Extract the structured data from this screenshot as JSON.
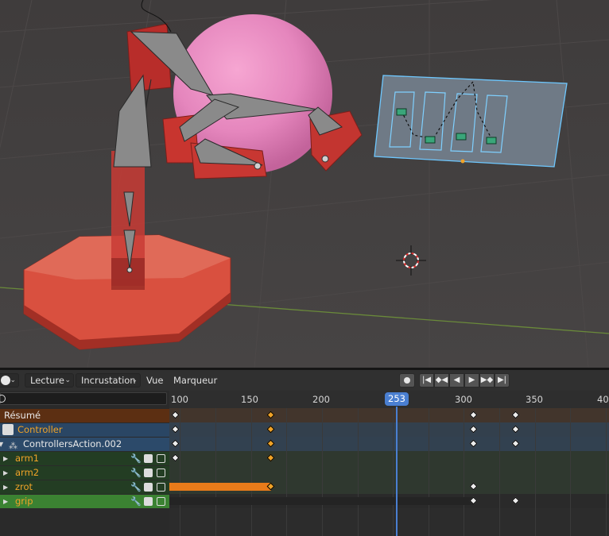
{
  "header": {
    "mode_icon": "dopesheet-mode-icon",
    "menus": {
      "playback": "Lecture",
      "keying": "Incrustation",
      "view": "Vue",
      "marker": "Marqueur"
    },
    "playback_buttons": [
      "record-icon",
      "jump-start-icon",
      "prev-keyframe-icon",
      "play-reverse-icon",
      "play-icon",
      "next-keyframe-icon",
      "jump-end-icon"
    ]
  },
  "timeline": {
    "current_frame": "253",
    "tick_labels": [
      "100",
      "150",
      "200",
      "250",
      "300",
      "350",
      "40"
    ]
  },
  "channels": [
    {
      "label": "Résumé",
      "kind": "summary"
    },
    {
      "label": "Controller",
      "kind": "object"
    },
    {
      "label": "ControllersAction.002",
      "kind": "action"
    },
    {
      "label": "arm1",
      "kind": "group"
    },
    {
      "label": "arm2",
      "kind": "group"
    },
    {
      "label": "zrot",
      "kind": "group"
    },
    {
      "label": "grip",
      "kind": "group-selected"
    }
  ],
  "keyframes": {
    "summary": [
      97,
      164,
      307,
      337
    ],
    "controller": [
      97,
      164,
      307,
      337
    ],
    "action": [
      97,
      164,
      307,
      337
    ],
    "arm1": [
      97,
      164
    ],
    "arm2": [],
    "zrot": [
      164,
      307
    ],
    "grip": [
      307,
      337
    ]
  },
  "colors": {
    "summary_row": "#5c2f12",
    "object_row": "#2a4664",
    "action_row": "#2c4a6a",
    "group_row": "#233d23",
    "group_selected_row": "#3b8232",
    "keyframe_selected": "#f0a328",
    "keyframe_normal": "#ededed",
    "playhead": "#4a7fd1",
    "hold_bar": "#e97b1a"
  }
}
